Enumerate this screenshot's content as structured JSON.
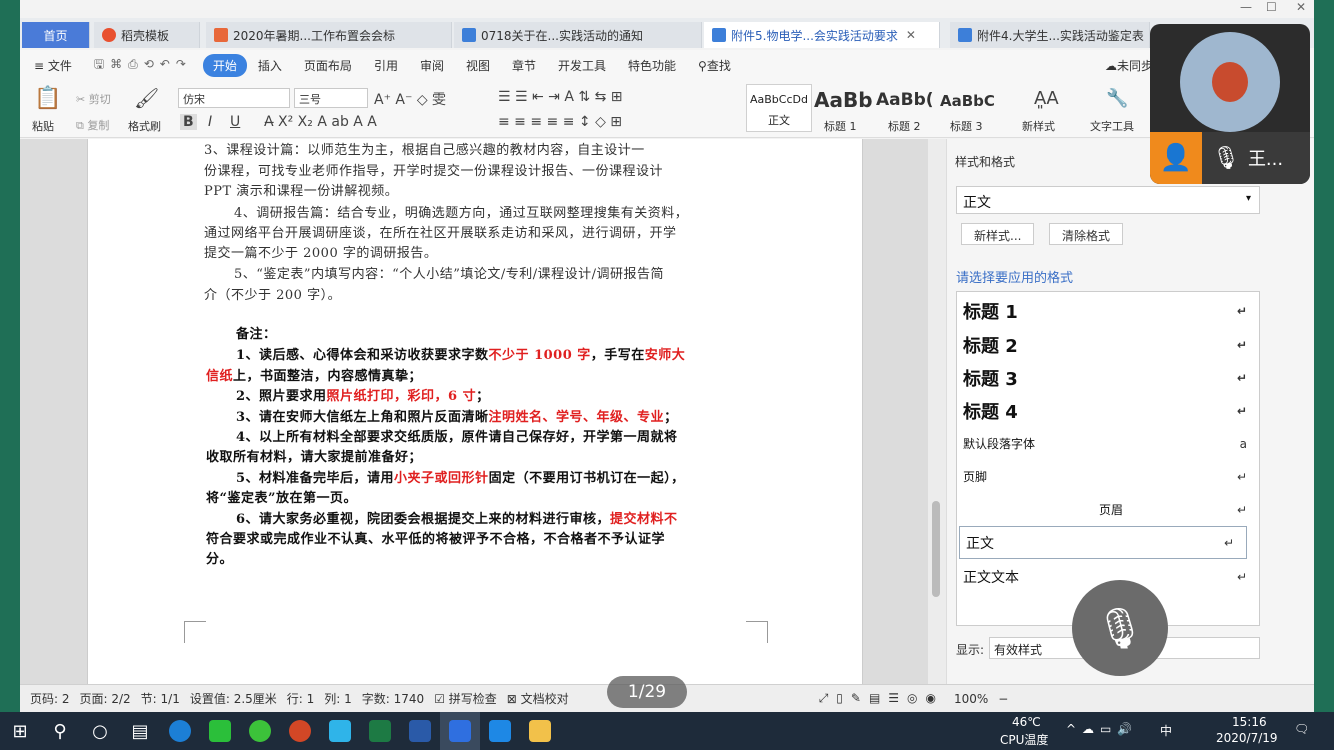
{
  "tabs": [
    {
      "label": "首页"
    },
    {
      "label": "稻壳模板"
    },
    {
      "label": "2020年暑期...工作布置会会标"
    },
    {
      "label": "0718关于在...实践活动的通知"
    },
    {
      "label": "附件5.物电学...会实践活动要求"
    },
    {
      "label": "附件4.大学生...实践活动鉴定表"
    }
  ],
  "menu": {
    "file": "文件",
    "items": [
      "开始",
      "插入",
      "页面布局",
      "引用",
      "审阅",
      "视图",
      "章节",
      "开发工具",
      "特色功能"
    ],
    "search": "查找",
    "sync": "未同步"
  },
  "ribbon": {
    "paste": "粘贴",
    "cut": "剪切",
    "copy": "复制",
    "format_painter": "格式刷",
    "font": "仿宋",
    "size": "三号",
    "styles": [
      {
        "preview": "AaBbCcDd",
        "label": "正文"
      },
      {
        "preview": "AaBb",
        "label": "标题 1"
      },
      {
        "preview": "AaBb(",
        "label": "标题 2"
      },
      {
        "preview": "AaBbC",
        "label": "标题 3"
      }
    ],
    "new_style": "新样式",
    "text_tools": "文字工具"
  },
  "doc": {
    "lines": [
      "3、课程设计篇：以师范生为主，根据自己感兴趣的教材内容，自主设计一",
      "份课程，可找专业老师作指导，开学时提交一份课程设计报告、一份课程设计",
      "PPT 演示和课程一份讲解视频。",
      "4、调研报告篇：结合专业，明确选题方向，通过互联网整理搜集有关资料，",
      "通过网络平台开展调研座谈，在所在社区开展联系走访和采风，进行调研，开学",
      "提交一篇不少于 2000 字的调研报告。",
      "5、“鉴定表”内填写内容：“个人小结”填论文/专利/课程设计/调研报告简",
      "介（不少于 200 字）。"
    ],
    "note_title": "备注：",
    "n1a": "1、读后感、心得体会和采访收获要求字数",
    "n1b": "不少于 1000 字",
    "n1c": "，手写在",
    "n1d": "安师大",
    "n1e": "信纸",
    "n1f": "上，书面整洁，内容感情真挚；",
    "n2a": "2、照片要求用",
    "n2b": "照片纸打印，彩印，6 寸",
    "n2c": "；",
    "n3a": "3、请在安师大信纸左上角和照片反面清晰",
    "n3b": "注明姓名、学号、年级、专业",
    "n3c": "；",
    "n4a": "4、以上所有材料全部要求交纸质版，原件请自己保存好，开学第一周就将",
    "n4b": "收取所有材料，请大家提前准备好；",
    "n5a": "5、材料准备完毕后，请用",
    "n5b": "小夹子或回形针",
    "n5c": "固定（不要用订书机订在一起），",
    "n5d": "将“鉴定表”放在第一页。",
    "n6a": "6、请大家务必重视，院团委会根据提交上来的材料进行审核，",
    "n6b": "提交材料不",
    "n6c": "符合要求或完成作业不认真、水平低的将被评予不合格，不合格者不予认证学",
    "n6d": "分。"
  },
  "pane": {
    "title": "样式和格式",
    "current": "正文",
    "new_btn": "新样式...",
    "clear_btn": "清除格式",
    "hint": "请选择要应用的格式",
    "styles": [
      "标题  1",
      "标题  2",
      "标题  3",
      "标题  4",
      "默认段落字体",
      "页脚",
      "页眉",
      "正文",
      "正文文本"
    ],
    "show_label": "显示:",
    "show_value": "有效样式"
  },
  "status": {
    "page_code": "页码: 2",
    "pages": "页面: 2/2",
    "section": "节: 1/1",
    "setting": "设置值: 2.5厘米",
    "row": "行: 1",
    "col": "列: 1",
    "words": "字数: 1740",
    "spell": "拼写检查",
    "proof": "文档校对",
    "zoom": "100%"
  },
  "pager": "1/29",
  "video": {
    "name": "王..."
  },
  "taskbar": {
    "temp": "46℃",
    "temp_label": "CPU温度",
    "ime": "中",
    "time": "15:16",
    "date": "2020/7/19"
  }
}
